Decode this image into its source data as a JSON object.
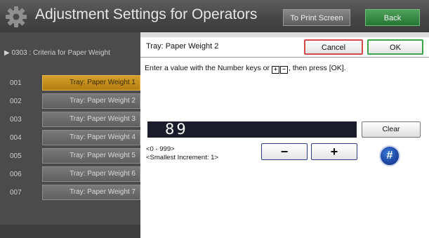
{
  "header": {
    "title": "Adjustment Settings for Operators",
    "print_screen_label": "To Print Screen",
    "back_label": "Back"
  },
  "left_panel": {
    "breadcrumb": "▶ 0303 : Criteria for Paper Weight",
    "rows": [
      {
        "num": "001",
        "label": "Tray: Paper Weight 1",
        "selected": true
      },
      {
        "num": "002",
        "label": "Tray: Paper Weight 2",
        "selected": false
      },
      {
        "num": "003",
        "label": "Tray: Paper Weight 3",
        "selected": false
      },
      {
        "num": "004",
        "label": "Tray: Paper Weight 4",
        "selected": false
      },
      {
        "num": "005",
        "label": "Tray: Paper Weight 5",
        "selected": false
      },
      {
        "num": "006",
        "label": "Tray: Paper Weight 6",
        "selected": false
      },
      {
        "num": "007",
        "label": "Tray: Paper Weight 7",
        "selected": false
      }
    ]
  },
  "dialog": {
    "title": "Tray: Paper Weight 2",
    "cancel_label": "Cancel",
    "ok_label": "OK",
    "instruction_before": "Enter a value with the Number keys or ",
    "instruction_keys": [
      "+",
      "−"
    ],
    "instruction_after": ", then press [OK].",
    "value": "89",
    "clear_label": "Clear",
    "range_text": "<0 - 999>",
    "increment_text": "<Smallest Increment: 1>",
    "minus_label": "−",
    "plus_label": "+",
    "hash_label": "#"
  },
  "colors": {
    "selected_row": "#c28c1a",
    "cancel_border": "#d44a4a",
    "ok_border": "#3aa54a",
    "back_button": "#2f8a3e",
    "number_field": "#1b1d2c",
    "hash_button": "#1f4aa8"
  },
  "icons": {
    "header_icon": "gear-icon"
  }
}
